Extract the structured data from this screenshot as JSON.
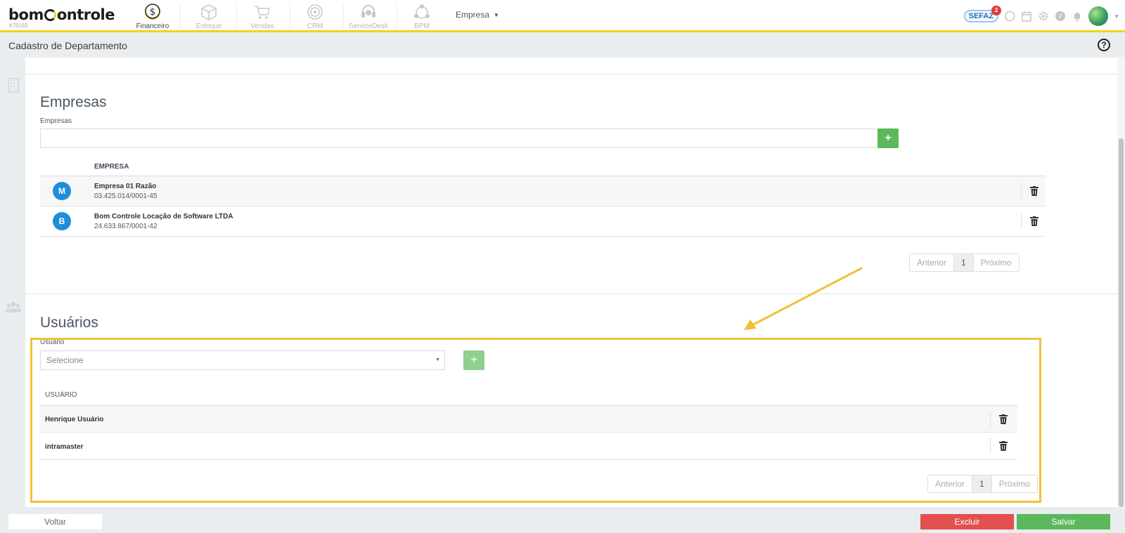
{
  "brand": {
    "logo_prefix": "bom",
    "logo_suffix": "ontrole",
    "company_id": "#76165"
  },
  "modules": [
    {
      "label": "Financeiro",
      "icon": "finance-coin-icon",
      "active": true
    },
    {
      "label": "Estoque",
      "icon": "box-icon",
      "active": false
    },
    {
      "label": "Vendas",
      "icon": "cart-icon",
      "active": false
    },
    {
      "label": "CRM",
      "icon": "target-icon",
      "active": false
    },
    {
      "label": "ServiceDesk",
      "icon": "headset-icon",
      "active": false
    },
    {
      "label": "BPM",
      "icon": "bpm-cycle-icon",
      "active": false
    }
  ],
  "empresa_menu": {
    "label": "Empresa",
    "caret": "▼"
  },
  "topbar_right": {
    "sefaz_label": "SEFAZ",
    "sefaz_badge": "2"
  },
  "page": {
    "title": "Cadastro de Departamento",
    "help_symbol": "?"
  },
  "empresas_section": {
    "title": "Empresas",
    "field_label": "Empresas",
    "select_value": "",
    "add_symbol": "+",
    "table_header": "EMPRESA",
    "rows": [
      {
        "initial": "M",
        "name": "Empresa 01 Razão",
        "cnpj": "03.425.014/0001-45"
      },
      {
        "initial": "B",
        "name": "Bom Controle Locação de Software LTDA",
        "cnpj": "24.633.867/0001-42"
      }
    ],
    "pager": {
      "prev": "Anterior",
      "page": "1",
      "next": "Próximo"
    }
  },
  "usuarios_section": {
    "title": "Usuários",
    "field_label": "Usuário",
    "select_placeholder": "Selecione",
    "add_symbol": "+",
    "table_header": "USUÁRIO",
    "rows": [
      {
        "name": "Henrique Usuário"
      },
      {
        "name": "intramaster"
      }
    ],
    "pager": {
      "prev": "Anterior",
      "page": "1",
      "next": "Próximo"
    }
  },
  "footer": {
    "back_label": "Voltar",
    "delete_label": "Excluir",
    "save_label": "Salvar"
  },
  "colors": {
    "accent_yellow": "#f2d21e",
    "highlight": "#f0c13a",
    "success": "#5cb85c",
    "danger": "#e25050",
    "avatar_blue": "#1e8ed8"
  }
}
